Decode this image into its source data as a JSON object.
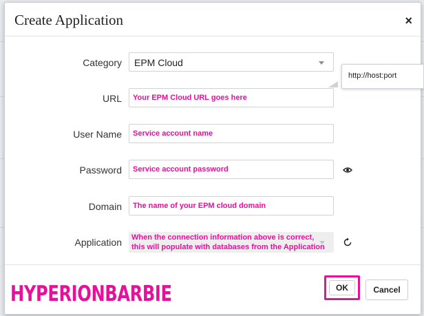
{
  "dialog": {
    "title": "Create Application",
    "close_label": "×"
  },
  "form": {
    "category": {
      "label": "Category",
      "value": "EPM Cloud"
    },
    "url": {
      "label": "URL",
      "value": "Your EPM Cloud URL goes here"
    },
    "user_name": {
      "label": "User Name",
      "value": "Service account name"
    },
    "password": {
      "label": "Password",
      "value": "Service account password"
    },
    "domain": {
      "label": "Domain",
      "value": "The name of your EPM cloud domain"
    },
    "application": {
      "label": "Application",
      "value_line1": "When the connection information above is correct,",
      "value_line2": "this will populate with databases from the Application"
    }
  },
  "tooltip": {
    "text": "http://host:port"
  },
  "buttons": {
    "ok": "OK",
    "cancel": "Cancel"
  },
  "watermark": "HYPERIONBARBIE",
  "icons": {
    "dropdown": "chevron-down-icon",
    "show_password": "eye-icon",
    "refresh": "refresh-icon",
    "close": "close-icon"
  },
  "colors": {
    "annotation": "#e6109a",
    "highlight_border": "#e6109a",
    "disabled_field": "#eeeeef"
  }
}
